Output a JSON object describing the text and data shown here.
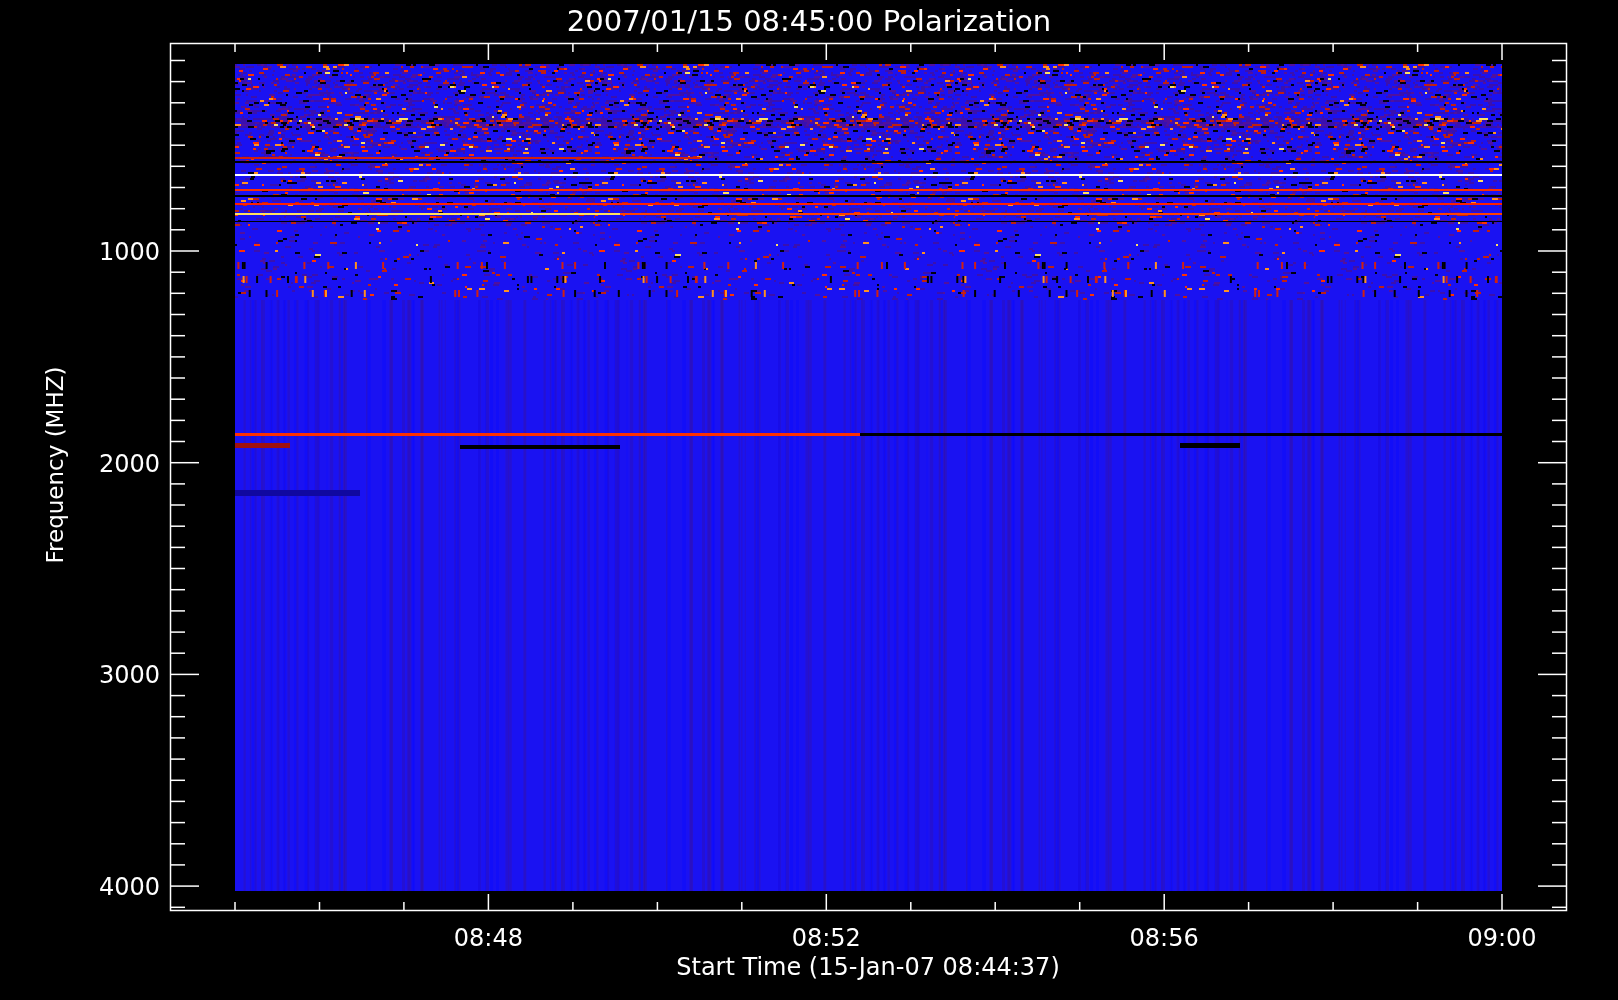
{
  "title": "2007/01/15 08:45:00 Polarization",
  "x_axis": {
    "label": "Start Time (15-Jan-07 08:44:37)",
    "ticks": [
      "08:48",
      "08:52",
      "08:56",
      "09:00"
    ]
  },
  "y_axis": {
    "label": "Frequency (MHZ)",
    "ticks": [
      "1000",
      "2000",
      "3000",
      "4000"
    ]
  }
}
